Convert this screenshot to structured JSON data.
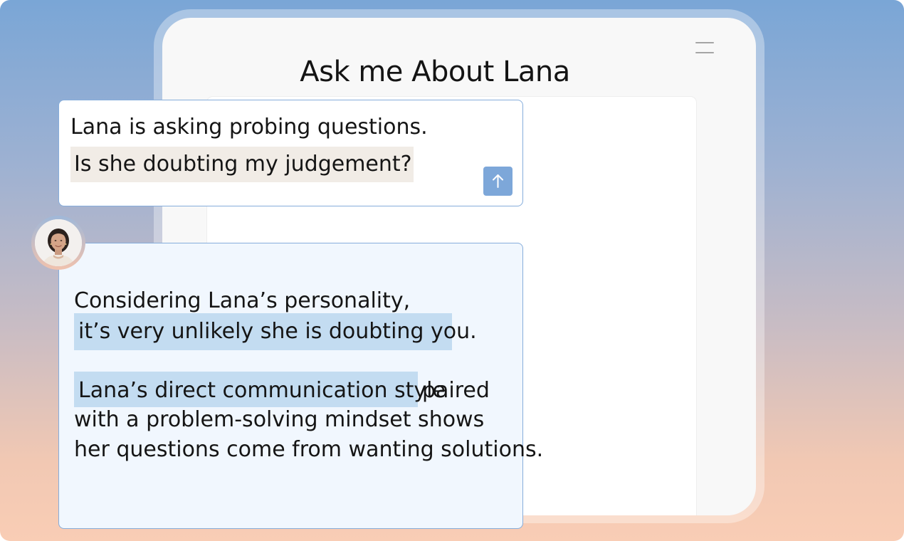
{
  "app": {
    "title": "Ask me About Lana"
  },
  "header": {
    "menu_icon": "hamburger-menu-icon"
  },
  "question": {
    "line1": "Lana is asking probing questions.",
    "line2": "Is she doubting my judgement?",
    "send_icon": "arrow-up-icon"
  },
  "answer": {
    "avatar": "person-avatar",
    "line1": "Considering Lana’s personality,",
    "line2": "it’s very unlikely she is doubting you.",
    "line3_highlight": "Lana’s direct communication style",
    "line3_rest": "paired",
    "line4": "with a problem-solving mindset shows",
    "line5": "her questions come from wanting solutions."
  },
  "colors": {
    "accent_blue": "#7da7d9",
    "border_blue": "#86addb",
    "answer_bg": "#f1f7fe",
    "answer_highlight": "#c3dcf1",
    "question_highlight": "#f1ece6",
    "gradient_top": "#7aa6d6",
    "gradient_bottom": "#f9cdb5"
  }
}
